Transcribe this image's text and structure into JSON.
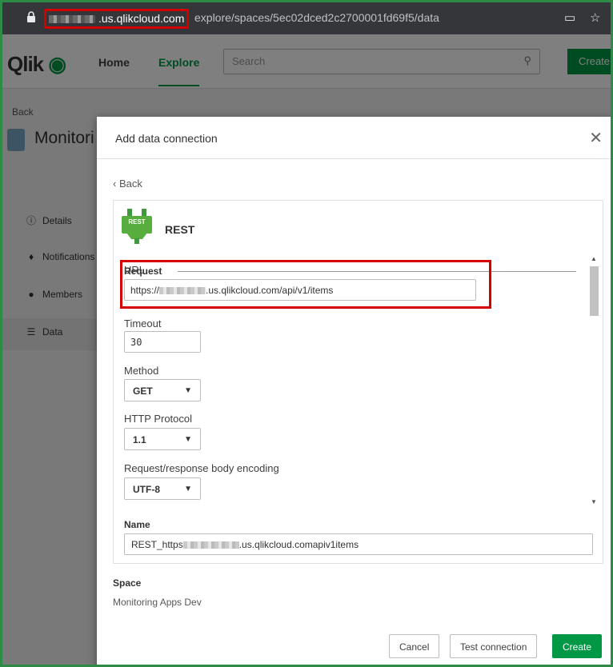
{
  "browser": {
    "host": ".us.qlikcloud.com",
    "path": "explore/spaces/5ec02dced2c2700001fd69f5/data",
    "icons": [
      "lock-icon",
      "cast-icon",
      "star-icon"
    ]
  },
  "topnav": {
    "logo": "Qlik",
    "home": "Home",
    "explore": "Explore",
    "search_placeholder": "Search",
    "create": "Create"
  },
  "page": {
    "back": "Back",
    "title": "Monitori",
    "sidebar": [
      {
        "label": "Details",
        "icon": "info-icon"
      },
      {
        "label": "Notifications",
        "icon": "bell-icon"
      },
      {
        "label": "Members",
        "icon": "members-icon"
      },
      {
        "label": "Data",
        "icon": "database-icon"
      }
    ]
  },
  "dialog": {
    "title": "Add data connection",
    "back": "Back",
    "connector": {
      "badge": "REST",
      "name": "REST"
    },
    "section_request": "Request",
    "url": {
      "label": "URL",
      "value_prefix": "https://",
      "value_suffix": ".us.qlikcloud.com/api/v1/items"
    },
    "timeout": {
      "label": "Timeout",
      "value": "30"
    },
    "method": {
      "label": "Method",
      "value": "GET"
    },
    "http_protocol": {
      "label": "HTTP Protocol",
      "value": "1.1"
    },
    "encoding": {
      "label": "Request/response body encoding",
      "value": "UTF-8"
    },
    "name": {
      "label": "Name",
      "value_prefix": "REST_https",
      "value_suffix": ".us.qlikcloud.comapiv1items"
    },
    "space": {
      "label": "Space",
      "value": "Monitoring Apps Dev"
    },
    "buttons": {
      "cancel": "Cancel",
      "test": "Test connection",
      "create": "Create"
    }
  },
  "colors": {
    "accent": "#009845",
    "highlight": "#d40000"
  }
}
